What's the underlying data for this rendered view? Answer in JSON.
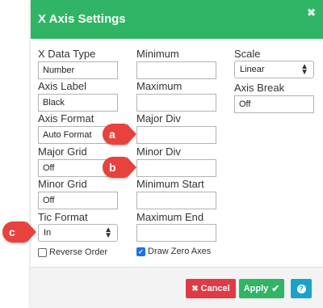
{
  "dialog": {
    "title": "X Axis Settings",
    "close_icon": "close-icon",
    "col1": {
      "x_data_type_label": "X Data Type",
      "x_data_type_value": "Number",
      "axis_label_label": "Axis Label",
      "axis_label_value": "Black",
      "axis_format_label": "Axis Format",
      "axis_format_value": "Auto Format",
      "major_grid_label": "Major Grid",
      "major_grid_value": "Off",
      "minor_grid_label": "Minor Grid",
      "minor_grid_value": "Off",
      "tic_format_label": "Tic Format",
      "tic_format_value": "In",
      "reverse_order_label": "Reverse Order",
      "reverse_order_checked": false
    },
    "col2": {
      "minimum_label": "Minimum",
      "minimum_value": "",
      "maximum_label": "Maximum",
      "maximum_value": "",
      "major_div_label": "Major Div",
      "major_div_value": "",
      "minor_div_label": "Minor Div",
      "minor_div_value": "",
      "minimum_start_label": "Minimum Start",
      "minimum_start_value": "",
      "maximum_end_label": "Maximum End",
      "maximum_end_value": "",
      "draw_zero_axes_label": "Draw Zero Axes",
      "draw_zero_axes_checked": true
    },
    "col3": {
      "scale_label": "Scale",
      "scale_value": "Linear",
      "axis_break_label": "Axis Break",
      "axis_break_value": "Off"
    },
    "footer": {
      "cancel_label": "Cancel",
      "apply_label": "Apply",
      "help_icon": "help-icon"
    }
  },
  "callouts": {
    "a": "a",
    "b": "b",
    "c": "c"
  },
  "colors": {
    "header": "#2fb565",
    "cancel": "#e03a45",
    "apply": "#2fb565",
    "help": "#1aa3c8",
    "callout": "#e8423f"
  }
}
